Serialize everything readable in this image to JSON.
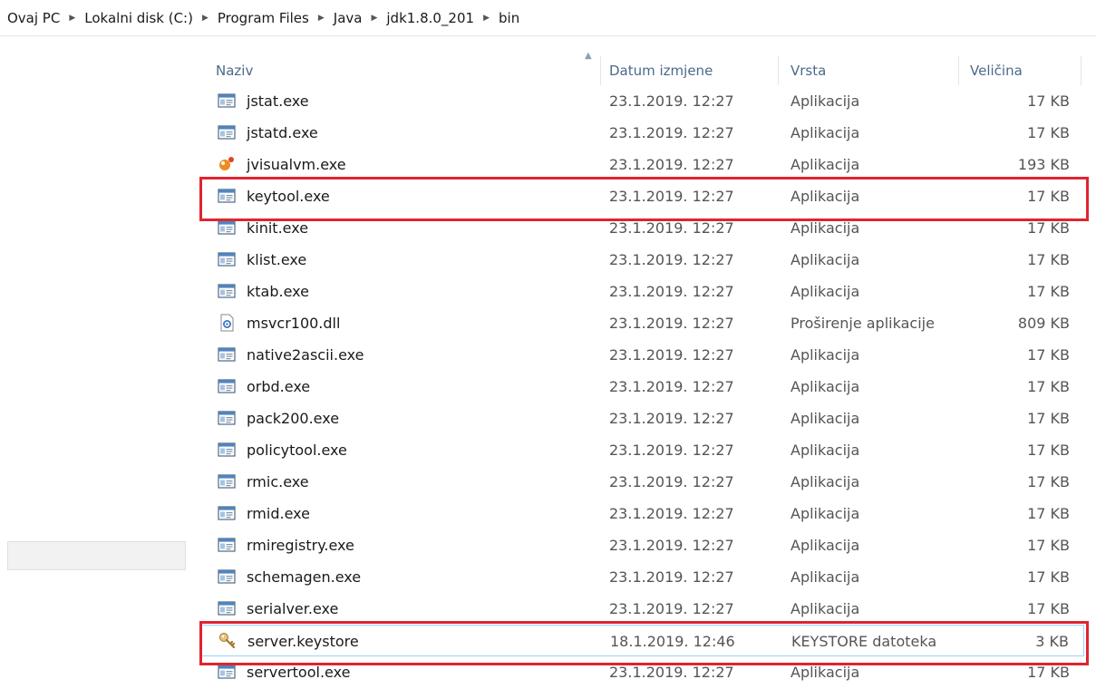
{
  "breadcrumb": [
    "Ovaj PC",
    "Lokalni disk (C:)",
    "Program Files",
    "Java",
    "jdk1.8.0_201",
    "bin"
  ],
  "columns": {
    "name": "Naziv",
    "date": "Datum izmjene",
    "type": "Vrsta",
    "size": "Veličina"
  },
  "files": [
    {
      "name": "jstat.exe",
      "date": "23.1.2019. 12:27",
      "type": "Aplikacija",
      "size": "17 KB",
      "icon": "app-window-icon"
    },
    {
      "name": "jstatd.exe",
      "date": "23.1.2019. 12:27",
      "type": "Aplikacija",
      "size": "17 KB",
      "icon": "app-window-icon"
    },
    {
      "name": "jvisualvm.exe",
      "date": "23.1.2019. 12:27",
      "type": "Aplikacija",
      "size": "193 KB",
      "icon": "jvisualvm-icon"
    },
    {
      "name": "keytool.exe",
      "date": "23.1.2019. 12:27",
      "type": "Aplikacija",
      "size": "17 KB",
      "icon": "app-window-icon"
    },
    {
      "name": "kinit.exe",
      "date": "23.1.2019. 12:27",
      "type": "Aplikacija",
      "size": "17 KB",
      "icon": "app-window-icon"
    },
    {
      "name": "klist.exe",
      "date": "23.1.2019. 12:27",
      "type": "Aplikacija",
      "size": "17 KB",
      "icon": "app-window-icon"
    },
    {
      "name": "ktab.exe",
      "date": "23.1.2019. 12:27",
      "type": "Aplikacija",
      "size": "17 KB",
      "icon": "app-window-icon"
    },
    {
      "name": "msvcr100.dll",
      "date": "23.1.2019. 12:27",
      "type": "Proširenje aplikacije",
      "size": "809 KB",
      "icon": "dll-gear-icon"
    },
    {
      "name": "native2ascii.exe",
      "date": "23.1.2019. 12:27",
      "type": "Aplikacija",
      "size": "17 KB",
      "icon": "app-window-icon"
    },
    {
      "name": "orbd.exe",
      "date": "23.1.2019. 12:27",
      "type": "Aplikacija",
      "size": "17 KB",
      "icon": "app-window-icon"
    },
    {
      "name": "pack200.exe",
      "date": "23.1.2019. 12:27",
      "type": "Aplikacija",
      "size": "17 KB",
      "icon": "app-window-icon"
    },
    {
      "name": "policytool.exe",
      "date": "23.1.2019. 12:27",
      "type": "Aplikacija",
      "size": "17 KB",
      "icon": "app-window-icon"
    },
    {
      "name": "rmic.exe",
      "date": "23.1.2019. 12:27",
      "type": "Aplikacija",
      "size": "17 KB",
      "icon": "app-window-icon"
    },
    {
      "name": "rmid.exe",
      "date": "23.1.2019. 12:27",
      "type": "Aplikacija",
      "size": "17 KB",
      "icon": "app-window-icon"
    },
    {
      "name": "rmiregistry.exe",
      "date": "23.1.2019. 12:27",
      "type": "Aplikacija",
      "size": "17 KB",
      "icon": "app-window-icon"
    },
    {
      "name": "schemagen.exe",
      "date": "23.1.2019. 12:27",
      "type": "Aplikacija",
      "size": "17 KB",
      "icon": "app-window-icon"
    },
    {
      "name": "serialver.exe",
      "date": "23.1.2019. 12:27",
      "type": "Aplikacija",
      "size": "17 KB",
      "icon": "app-window-icon"
    },
    {
      "name": "server.keystore",
      "date": "18.1.2019. 12:46",
      "type": "KEYSTORE datoteka",
      "size": "3 KB",
      "icon": "keystore-key-icon"
    },
    {
      "name": "servertool.exe",
      "date": "23.1.2019. 12:27",
      "type": "Aplikacija",
      "size": "17 KB",
      "icon": "app-window-icon"
    }
  ],
  "selected_file": "server.keystore",
  "highlighted_files": [
    "keytool.exe",
    "server.keystore"
  ],
  "colors": {
    "highlight": "#e0242f",
    "selection_border": "#99d1ff",
    "header_text": "#4a6a8a"
  }
}
